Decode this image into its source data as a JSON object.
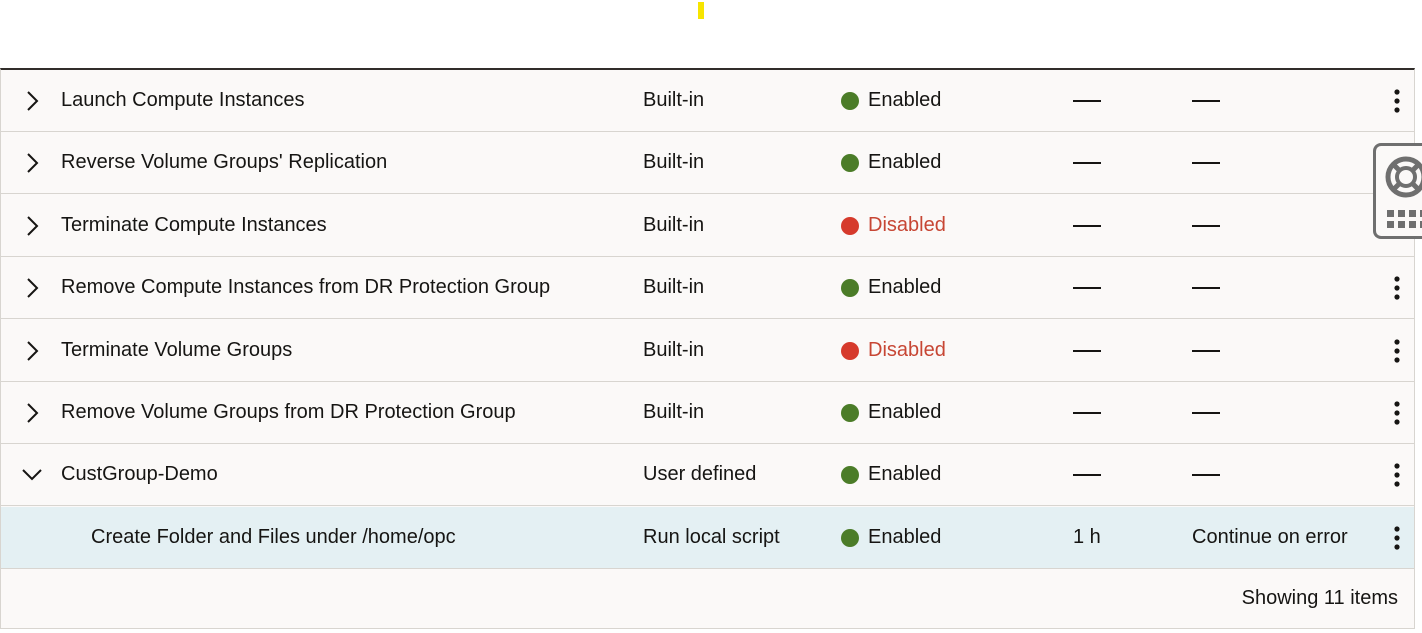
{
  "colors": {
    "enabled": "#4b7c28",
    "disabled": "#d63a2c",
    "selected_row": "#e4f0f3",
    "header_border": "#312d2a"
  },
  "rows": [
    {
      "name": "Launch Compute Instances",
      "type": "Built-in",
      "status": "Enabled",
      "timeout": "",
      "on_error": "",
      "expand": "collapsed"
    },
    {
      "name": "Reverse Volume Groups' Replication",
      "type": "Built-in",
      "status": "Enabled",
      "timeout": "",
      "on_error": "",
      "expand": "collapsed"
    },
    {
      "name": "Terminate Compute Instances",
      "type": "Built-in",
      "status": "Disabled",
      "timeout": "",
      "on_error": "",
      "expand": "collapsed"
    },
    {
      "name": "Remove Compute Instances from DR Protection Group",
      "type": "Built-in",
      "status": "Enabled",
      "timeout": "",
      "on_error": "",
      "expand": "collapsed"
    },
    {
      "name": "Terminate Volume Groups",
      "type": "Built-in",
      "status": "Disabled",
      "timeout": "",
      "on_error": "",
      "expand": "collapsed"
    },
    {
      "name": "Remove Volume Groups from DR Protection Group",
      "type": "Built-in",
      "status": "Enabled",
      "timeout": "",
      "on_error": "",
      "expand": "collapsed"
    },
    {
      "name": "CustGroup-Demo",
      "type": "User defined",
      "status": "Enabled",
      "timeout": "",
      "on_error": "",
      "expand": "expanded"
    },
    {
      "name": "Create Folder and Files under /home/opc",
      "type": "Run local script",
      "status": "Enabled",
      "timeout": "1 h",
      "on_error": "Continue on error",
      "expand": "child",
      "selected": true
    }
  ],
  "footer": {
    "summary": "Showing 11 items"
  },
  "help_widget": {
    "icons": [
      "lifebuoy-icon",
      "grid-icon"
    ]
  }
}
